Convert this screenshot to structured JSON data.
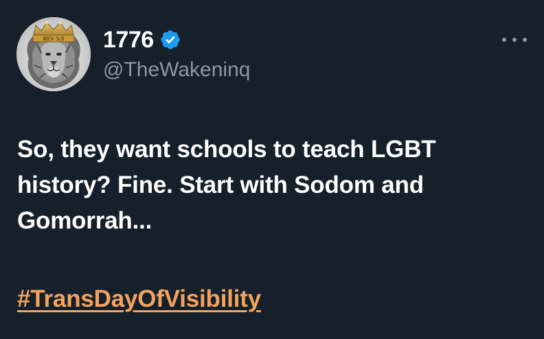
{
  "tweet": {
    "author": {
      "display_name": "1776",
      "handle": "@TheWakeninq",
      "verified": true,
      "avatar_icon": "lion-with-crown-avatar",
      "crown_text": "REV 5:5"
    },
    "more_icon": "more-options-icon",
    "body": "So, they want schools to teach LGBT history? Fine. Start with Sodom and Gomorrah...",
    "hashtag": "#TransDayOfVisibility"
  },
  "colors": {
    "background": "#15202b",
    "text": "#ffffff",
    "secondary_text": "#8b98a5",
    "verified_badge": "#1d9bf0",
    "hashtag": "#f4a35e"
  }
}
